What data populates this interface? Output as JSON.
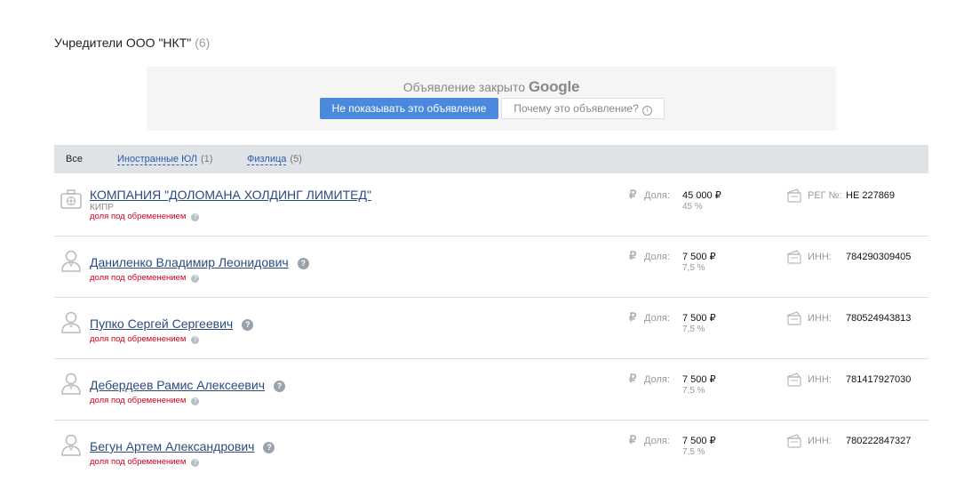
{
  "header": {
    "title": "Учредители ООО \"НКТ\"",
    "count": "(6)"
  },
  "ad": {
    "closed_text": "Объявление закрыто",
    "google_text": "Google",
    "hide_button": "Не показывать это объявление",
    "why_button": "Почему это объявление?",
    "info_icon": "i"
  },
  "tabs": [
    {
      "label": "Все",
      "count": ""
    },
    {
      "label": "Иностранные ЮЛ",
      "count": "(1)"
    },
    {
      "label": "Физлица",
      "count": "(5)"
    }
  ],
  "icons": {
    "question": "?",
    "ruble": "₽"
  },
  "rows": [
    {
      "name": "КОМПАНИЯ \"ДОЛОМАНА ХОЛДИНГ ЛИМИТЕД\"",
      "country": "КИПР",
      "encumbrance": "доля под обременением",
      "share_label": "Доля:",
      "share_value": "45 000 ₽",
      "share_percent": "45 %",
      "id_label": "РЕГ №:",
      "id_value": "HE 227869"
    },
    {
      "name": "Даниленко Владимир Леонидович",
      "encumbrance": "доля под обременением",
      "share_label": "Доля:",
      "share_value": "7 500 ₽",
      "share_percent": "7,5 %",
      "id_label": "ИНН:",
      "id_value": "784290309405"
    },
    {
      "name": "Пупко Сергей Сергеевич",
      "encumbrance": "доля под обременением",
      "share_label": "Доля:",
      "share_value": "7 500 ₽",
      "share_percent": "7,5 %",
      "id_label": "ИНН:",
      "id_value": "780524943813"
    },
    {
      "name": "Дебердеев Рамис Алексеевич",
      "encumbrance": "доля под обременением",
      "share_label": "Доля:",
      "share_value": "7 500 ₽",
      "share_percent": "7,5 %",
      "id_label": "ИНН:",
      "id_value": "781417927030"
    },
    {
      "name": "Бегун Артем Александрович",
      "encumbrance": "доля под обременением",
      "share_label": "Доля:",
      "share_value": "7 500 ₽",
      "share_percent": "7,5 %",
      "id_label": "ИНН:",
      "id_value": "780222847327"
    }
  ]
}
